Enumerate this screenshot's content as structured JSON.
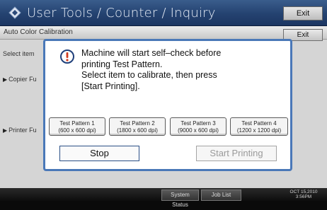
{
  "titlebar": {
    "title": "User Tools / Counter / Inquiry",
    "exit_label": "Exit"
  },
  "panel": {
    "title": "Auto Color Calibration",
    "exit_label": "Exit",
    "select_label": "Select item",
    "copier_label": "Copier Fu",
    "printer_label": "Printer Fu"
  },
  "dialog": {
    "message_lines": [
      "Machine will start self–check before",
      "printing Test Pattern.",
      "Select item to calibrate, then press",
      "[Start Printing]."
    ],
    "patterns": [
      {
        "label": "Test Pattern 1",
        "resolution": "(600 x 600 dpi)"
      },
      {
        "label": "Test Pattern 2",
        "resolution": "(1800 x 600 dpi)"
      },
      {
        "label": "Test Pattern 3",
        "resolution": "(9000 x 600 dpi)"
      },
      {
        "label": "Test Pattern 4",
        "resolution": "(1200 x 1200 dpi)"
      }
    ],
    "stop_label": "Stop",
    "start_label": "Start Printing"
  },
  "statusbar": {
    "system_status": "System Status",
    "job_list": "Job List",
    "date": "OCT  15,2010",
    "time": "3:56PM"
  },
  "colors": {
    "titlebar_blue": "#244270",
    "dialog_border": "#4a78b8",
    "warning_red": "#d23a1e"
  }
}
